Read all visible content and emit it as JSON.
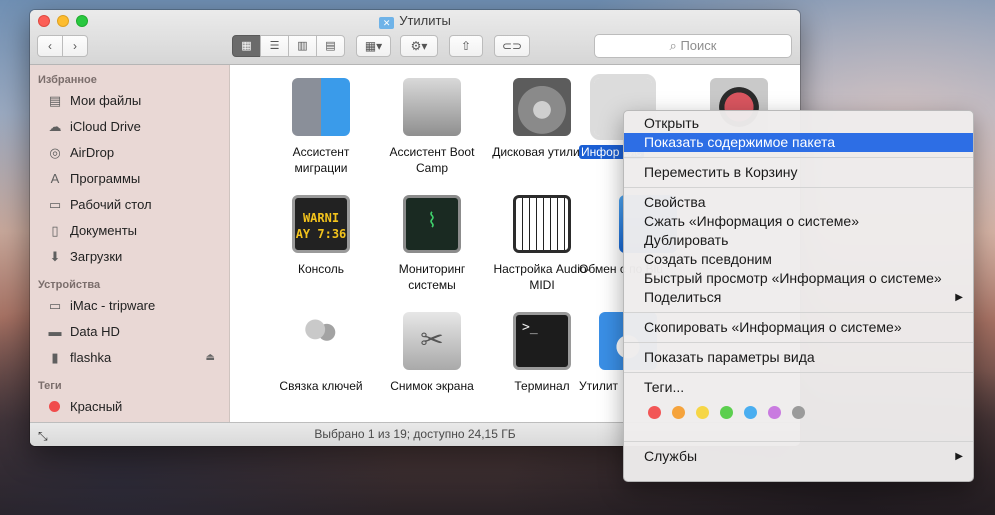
{
  "window": {
    "title": "Утилиты",
    "search_placeholder": "Поиск",
    "status": "Выбрано 1 из 19; доступно 24,15 ГБ"
  },
  "sidebar": {
    "favorites_header": "Избранное",
    "favorites": [
      {
        "label": "Мои файлы",
        "icon": "all-files-icon"
      },
      {
        "label": "iCloud Drive",
        "icon": "cloud-icon"
      },
      {
        "label": "AirDrop",
        "icon": "airdrop-icon"
      },
      {
        "label": "Программы",
        "icon": "applications-icon"
      },
      {
        "label": "Рабочий стол",
        "icon": "desktop-icon"
      },
      {
        "label": "Документы",
        "icon": "documents-icon"
      },
      {
        "label": "Загрузки",
        "icon": "downloads-icon"
      }
    ],
    "devices_header": "Устройства",
    "devices": [
      {
        "label": "iMac - tripware",
        "icon": "imac-icon"
      },
      {
        "label": "Data HD",
        "icon": "hard-drive-icon"
      },
      {
        "label": "flashka",
        "icon": "usb-drive-icon"
      }
    ],
    "tags_header": "Теги",
    "tags": [
      {
        "label": "Красный",
        "color": "#f04c4c"
      }
    ]
  },
  "files": [
    {
      "label": "Ассистент миграции",
      "icon": "migration-assistant-icon"
    },
    {
      "label": "Ассистент Boot Camp",
      "icon": "boot-camp-icon"
    },
    {
      "label": "Дисковая утилита",
      "icon": "disk-utility-icon"
    },
    {
      "label": "Инфор сис",
      "icon": "system-information-icon",
      "selected": true
    },
    {
      "label": "",
      "icon": "color-meter-icon"
    },
    {
      "label": "Консоль",
      "icon": "console-icon",
      "icon_text": "WARNI\nAY 7:36"
    },
    {
      "label": "Мониторинг системы",
      "icon": "activity-monitor-icon"
    },
    {
      "label": "Настройка Audio-MIDI",
      "icon": "audio-midi-icon"
    },
    {
      "label": "Обмен с по Blu",
      "icon": "bluetooth-exchange-icon"
    },
    {
      "label": "Связка ключей",
      "icon": "keychain-icon"
    },
    {
      "label": "Снимок экрана",
      "icon": "screenshot-icon"
    },
    {
      "label": "Терминал",
      "icon": "terminal-icon",
      "icon_text": ">_"
    },
    {
      "label": "Утилит",
      "icon": "utility-icon"
    }
  ],
  "context_menu": {
    "items": [
      "Открыть",
      "Показать содержимое пакета",
      "Переместить в Корзину",
      "Свойства",
      "Сжать «Информация о системе»",
      "Дублировать",
      "Создать псевдоним",
      "Быстрый просмотр «Информация о системе»",
      "Поделиться",
      "Скопировать «Информация о системе»",
      "Показать параметры вида",
      "Теги...",
      "Службы"
    ],
    "tag_colors": [
      "#f25656",
      "#f5a33c",
      "#f6d646",
      "#5ccf4f",
      "#4aaef0",
      "#c97be0",
      "#9b9b9b"
    ]
  }
}
